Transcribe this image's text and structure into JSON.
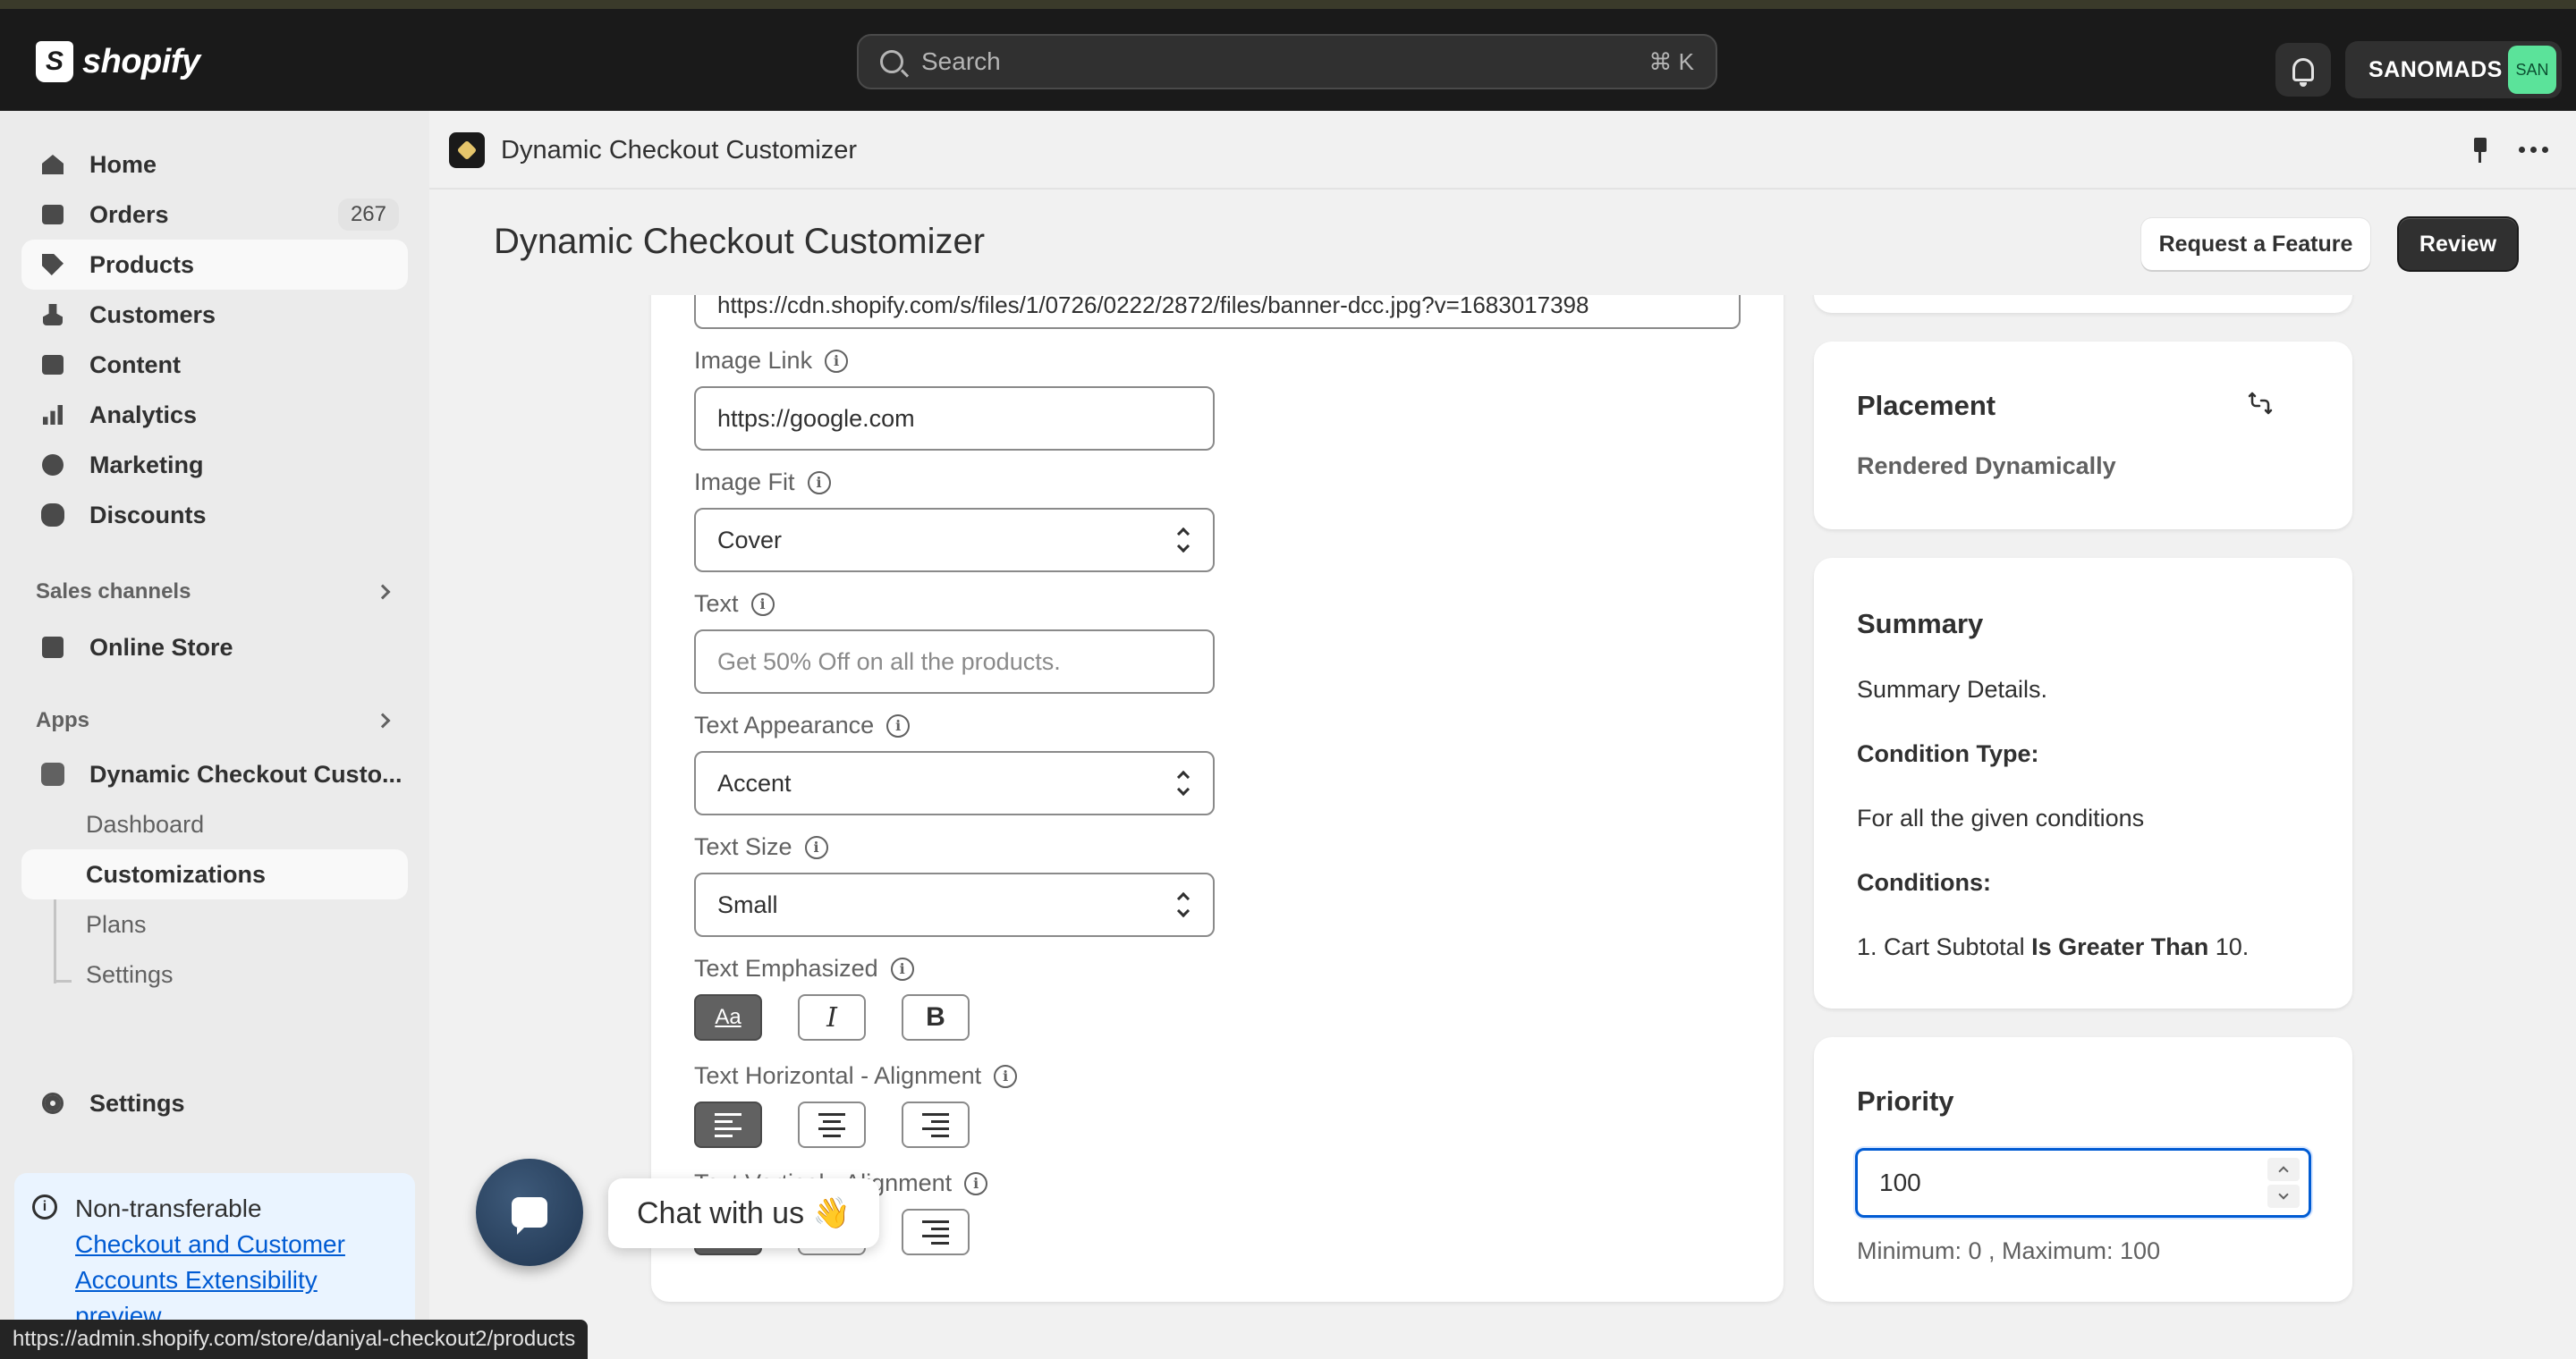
{
  "topbar": {
    "logo_text": "shopify",
    "search_placeholder": "Search",
    "search_shortcut": "⌘ K",
    "store_name": "SANOMADS",
    "store_avatar": "SAN"
  },
  "sidebar": {
    "items": [
      {
        "label": "Home",
        "icon": "home-icon"
      },
      {
        "label": "Orders",
        "icon": "inbox-icon",
        "badge": "267"
      },
      {
        "label": "Products",
        "icon": "tag-icon"
      },
      {
        "label": "Customers",
        "icon": "person-icon"
      },
      {
        "label": "Content",
        "icon": "image-icon"
      },
      {
        "label": "Analytics",
        "icon": "bar-chart-icon"
      },
      {
        "label": "Marketing",
        "icon": "target-icon"
      },
      {
        "label": "Discounts",
        "icon": "discount-icon"
      }
    ],
    "sales_channels_title": "Sales channels",
    "online_store": "Online Store",
    "apps_title": "Apps",
    "app_name": "Dynamic Checkout Custo...",
    "app_sub_items": [
      "Dashboard",
      "Customizations",
      "Plans",
      "Settings"
    ],
    "settings": "Settings",
    "notice": {
      "title": "Non-transferable",
      "link": "Checkout and Customer Accounts Extensibility preview"
    },
    "status_url": "https://admin.shopify.com/store/daniyal-checkout2/products"
  },
  "app_header": {
    "title": "Dynamic Checkout Customizer"
  },
  "page": {
    "title": "Dynamic Checkout Customizer",
    "request_feature": "Request a Feature",
    "review": "Review"
  },
  "form": {
    "image_url": "https://cdn.shopify.com/s/files/1/0726/0222/2872/files/banner-dcc.jpg?v=1683017398",
    "image_link_label": "Image Link",
    "image_link_value": "https://google.com",
    "image_fit_label": "Image Fit",
    "image_fit_value": "Cover",
    "text_label": "Text",
    "text_placeholder": "Get 50% Off on all the products.",
    "text_appearance_label": "Text Appearance",
    "text_appearance_value": "Accent",
    "text_size_label": "Text Size",
    "text_size_value": "Small",
    "text_emphasized_label": "Text Emphasized",
    "emphasis_options": [
      "Aa",
      "I",
      "B"
    ],
    "horizontal_alignment_label": "Text Horizontal - Alignment",
    "vertical_alignment_label": "Text Vertical - Alignment"
  },
  "placement": {
    "heading": "Placement",
    "value": "Rendered Dynamically"
  },
  "summary": {
    "heading": "Summary",
    "details": "Summary Details.",
    "condition_type_label": "Condition Type:",
    "condition_type_value": "For all the given conditions",
    "conditions_label": "Conditions:",
    "condition_prefix": "1. Cart Subtotal",
    "condition_operator": "Is Greater Than",
    "condition_value": "10."
  },
  "priority": {
    "heading": "Priority",
    "value": "100",
    "hint": "Minimum: 0 , Maximum: 100"
  },
  "chat": {
    "label": "Chat with us 👋"
  },
  "colors": {
    "accent": "#005bd3",
    "topbar": "#1a1a1a",
    "avatar": "#5be39a"
  }
}
